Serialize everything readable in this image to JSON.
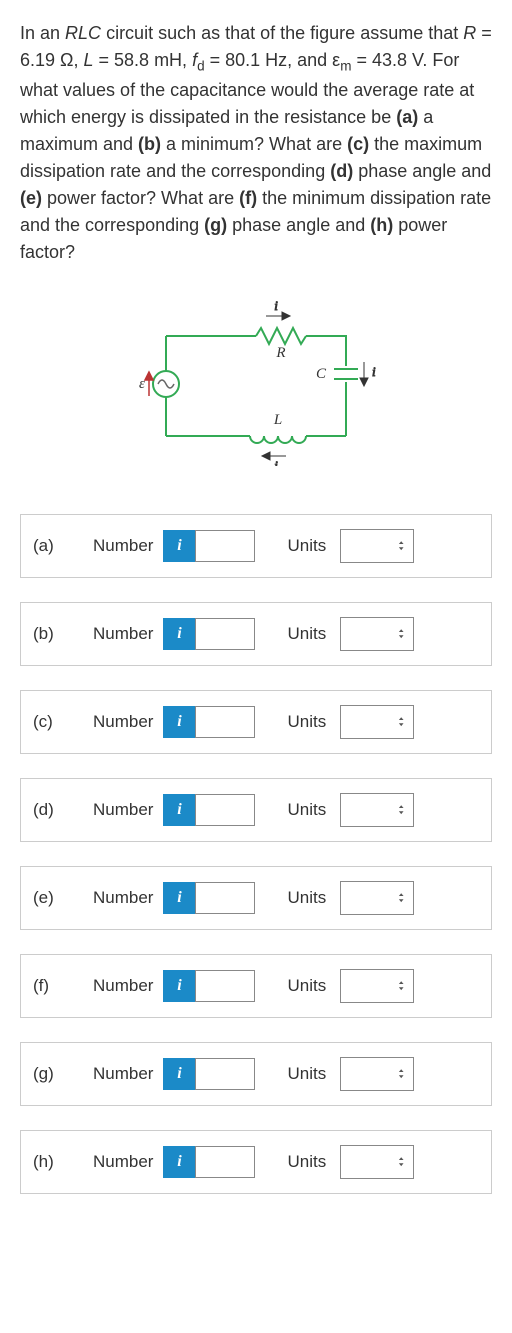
{
  "question": {
    "text": "In an RLC circuit such as that of the figure assume that R = 6.19 Ω, L = 58.8 mH, fᵈ = 80.1 Hz, and εₘ = 43.8 V. For what values of the capacitance would the average rate at which energy is dissipated in the resistance be (a) a maximum and (b) a minimum? What are (c) the maximum dissipation rate and the corresponding (d) phase angle and (e) power factor? What are (f) the minimum dissipation rate and the corresponding (g) phase angle and (h) power factor?"
  },
  "diagram": {
    "R_label": "R",
    "L_label": "L",
    "C_label": "C",
    "i_label": "i",
    "emf_label": "ε"
  },
  "rows": [
    {
      "id": "a",
      "label": "(a)",
      "numLabel": "Number",
      "info": "i",
      "unitsLabel": "Units"
    },
    {
      "id": "b",
      "label": "(b)",
      "numLabel": "Number",
      "info": "i",
      "unitsLabel": "Units"
    },
    {
      "id": "c",
      "label": "(c)",
      "numLabel": "Number",
      "info": "i",
      "unitsLabel": "Units"
    },
    {
      "id": "d",
      "label": "(d)",
      "numLabel": "Number",
      "info": "i",
      "unitsLabel": "Units"
    },
    {
      "id": "e",
      "label": "(e)",
      "numLabel": "Number",
      "info": "i",
      "unitsLabel": "Units"
    },
    {
      "id": "f",
      "label": "(f)",
      "numLabel": "Number",
      "info": "i",
      "unitsLabel": "Units"
    },
    {
      "id": "g",
      "label": "(g)",
      "numLabel": "Number",
      "info": "i",
      "unitsLabel": "Units"
    },
    {
      "id": "h",
      "label": "(h)",
      "numLabel": "Number",
      "info": "i",
      "unitsLabel": "Units"
    }
  ]
}
